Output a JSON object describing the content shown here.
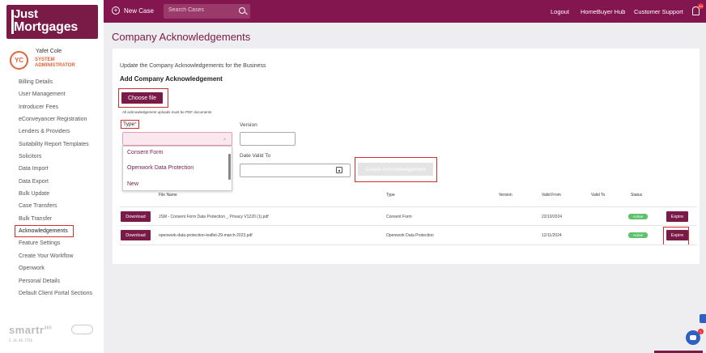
{
  "logo": {
    "line1": "Just",
    "line2": "Mortgages"
  },
  "user": {
    "initials": "YC",
    "name": "Yafet Cole",
    "role": "SYSTEM ADMINISTRATOR"
  },
  "sidebar": {
    "items": [
      {
        "label": "Billing Details"
      },
      {
        "label": "User Management"
      },
      {
        "label": "Introducer Fees"
      },
      {
        "label": "eConveyancer Registration"
      },
      {
        "label": "Lenders & Providers"
      },
      {
        "label": "Suitability Report Templates"
      },
      {
        "label": "Solicitors"
      },
      {
        "label": "Data Import"
      },
      {
        "label": "Data Export"
      },
      {
        "label": "Bulk Update"
      },
      {
        "label": "Case Transfers"
      },
      {
        "label": "Bulk Transfer"
      },
      {
        "label": "Acknowledgements"
      },
      {
        "label": "Feature Settings"
      },
      {
        "label": "Create Your Workflow"
      },
      {
        "label": "Openwork"
      },
      {
        "label": "Personal Details"
      },
      {
        "label": "Default Client Portal Sections"
      }
    ],
    "brand": "smartr",
    "brand_sup": "365",
    "version": "5.14.46.7756"
  },
  "topbar": {
    "new_case": "New Case",
    "search_placeholder": "Search Cases",
    "logout": "Logout",
    "homebuyer_hub": "HomeBuyer Hub",
    "customer_support": "Customer Support",
    "notification_count": "44"
  },
  "page": {
    "title": "Company Acknowledgements"
  },
  "form": {
    "intro": "Update the Company Acknowledgements for the Business",
    "section_title": "Add Company Acknowledgement",
    "choose_file": "Choose file",
    "note": "All acknowledgement uploads must be PDF documents",
    "type_label": "Type",
    "type_required": "*",
    "type_options": [
      "Consent Form",
      "Openwork Data Protection",
      "New"
    ],
    "version_label": "Version",
    "date_valid_to_label": "Date Valid To",
    "create_button": "Create Acknowledgement"
  },
  "table": {
    "headers": [
      "File Name",
      "Type",
      "Version",
      "Valid From",
      "Valid To",
      "Status"
    ],
    "rows": [
      {
        "download": "Download",
        "file": "JSM - Consent Form Data Protection _ Privacy V1220 (1).pdf",
        "type": "Consent Form",
        "version": "",
        "valid_from": "22/10/2024",
        "valid_to": "",
        "status": "Active",
        "expire": "Expire"
      },
      {
        "download": "Download",
        "file": "openwork-data-protection-leaflet-29-march-2023.pdf",
        "type": "Openwork Data Protection",
        "version": "",
        "valid_from": "12/11/2024",
        "valid_to": "",
        "status": "Active",
        "expire": "Expire"
      }
    ]
  },
  "chat": {
    "badge": "1"
  },
  "colors": {
    "brand": "#7a1a47",
    "topbar": "#83154f",
    "accent": "#e0653a",
    "active": "#5cc36b",
    "highlight": "#d03030"
  }
}
